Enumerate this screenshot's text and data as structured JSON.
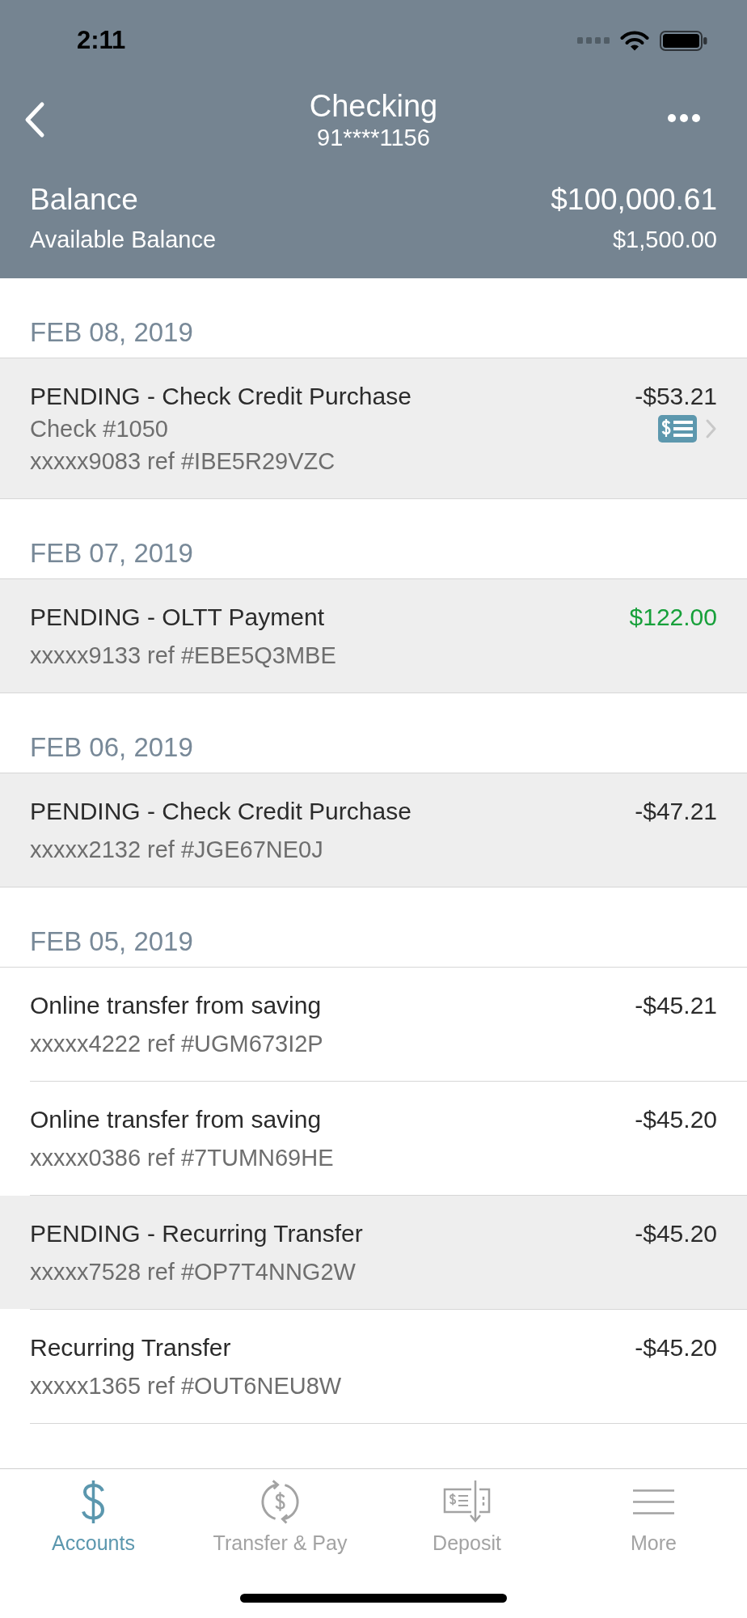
{
  "status_bar": {
    "time": "2:11"
  },
  "nav": {
    "title": "Checking",
    "account_number": "91****1156"
  },
  "balance": {
    "label": "Balance",
    "value": "$100,000.61"
  },
  "available_balance": {
    "label": "Available Balance",
    "value": "$1,500.00"
  },
  "groups": [
    {
      "date": "FEB 08, 2019",
      "transactions": [
        {
          "title": "PENDING - Check Credit Purchase",
          "details": [
            "Check #1050",
            "xxxxx9083 ref #IBE5R29VZC"
          ],
          "amount": "-$53.21",
          "pending": true,
          "credit": false,
          "check_image": true
        }
      ]
    },
    {
      "date": "FEB 07, 2019",
      "transactions": [
        {
          "title": "PENDING - OLTT Payment",
          "details": [
            "xxxxx9133 ref #EBE5Q3MBE"
          ],
          "amount": "$122.00",
          "pending": true,
          "credit": true,
          "check_image": false
        }
      ]
    },
    {
      "date": "FEB 06, 2019",
      "transactions": [
        {
          "title": "PENDING - Check Credit Purchase",
          "details": [
            "xxxxx2132 ref #JGE67NE0J"
          ],
          "amount": "-$47.21",
          "pending": true,
          "credit": false,
          "check_image": false
        }
      ]
    },
    {
      "date": "FEB 05, 2019",
      "transactions": [
        {
          "title": "Online transfer from saving",
          "details": [
            "xxxxx4222 ref #UGM673I2P"
          ],
          "amount": "-$45.21",
          "pending": false,
          "credit": false,
          "check_image": false
        },
        {
          "title": "Online transfer from saving",
          "details": [
            "xxxxx0386 ref #7TUMN69HE"
          ],
          "amount": "-$45.20",
          "pending": false,
          "credit": false,
          "check_image": false
        },
        {
          "title": "PENDING - Recurring Transfer",
          "details": [
            "xxxxx7528 ref #OP7T4NNG2W"
          ],
          "amount": "-$45.20",
          "pending": true,
          "credit": false,
          "check_image": false
        },
        {
          "title": "Recurring Transfer",
          "details": [
            "xxxxx1365 ref #OUT6NEU8W"
          ],
          "amount": "-$45.20",
          "pending": false,
          "credit": false,
          "check_image": false
        }
      ]
    }
  ],
  "tabs": [
    {
      "label": "Accounts",
      "selected": true
    },
    {
      "label": "Transfer & Pay",
      "selected": false
    },
    {
      "label": "Deposit",
      "selected": false
    },
    {
      "label": "More",
      "selected": false
    }
  ]
}
